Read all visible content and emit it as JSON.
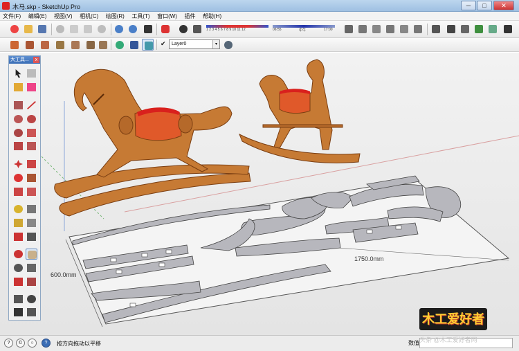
{
  "window": {
    "title": "木马.skp - SketchUp Pro",
    "minimize_label": "─",
    "maximize_label": "□",
    "close_label": "✕"
  },
  "menu": [
    {
      "label": "文件(F)"
    },
    {
      "label": "编辑(E)"
    },
    {
      "label": "视图(V)"
    },
    {
      "label": "相机(C)"
    },
    {
      "label": "绘图(R)"
    },
    {
      "label": "工具(T)"
    },
    {
      "label": "窗口(W)"
    },
    {
      "label": "插件"
    },
    {
      "label": "帮助(H)"
    }
  ],
  "shadow": {
    "months": "1 2 3 4 5 6 7 8 9 10 11 12",
    "time_start": "06:55",
    "time_mid": "中午",
    "time_end": "17:00"
  },
  "layer": {
    "current": "Layer0",
    "dropdown_glyph": "▾"
  },
  "tools_palette": {
    "title": "大工具...",
    "close_label": "x"
  },
  "model": {
    "dimension_width": "1750.0mm",
    "dimension_depth": "600.0mm",
    "colors": {
      "wood": "#c67a34",
      "wood_dark": "#7a3e12",
      "seat": "#e0592a",
      "seat_top": "#d9201d",
      "parts": "#b7b7bd",
      "parts_edge": "#444"
    }
  },
  "status": {
    "hint": "按方向拖动以平移",
    "measurements_label": "数值"
  },
  "logo": {
    "text": "木工爱好者"
  },
  "watermark": "头条 @木工爱好者网"
}
